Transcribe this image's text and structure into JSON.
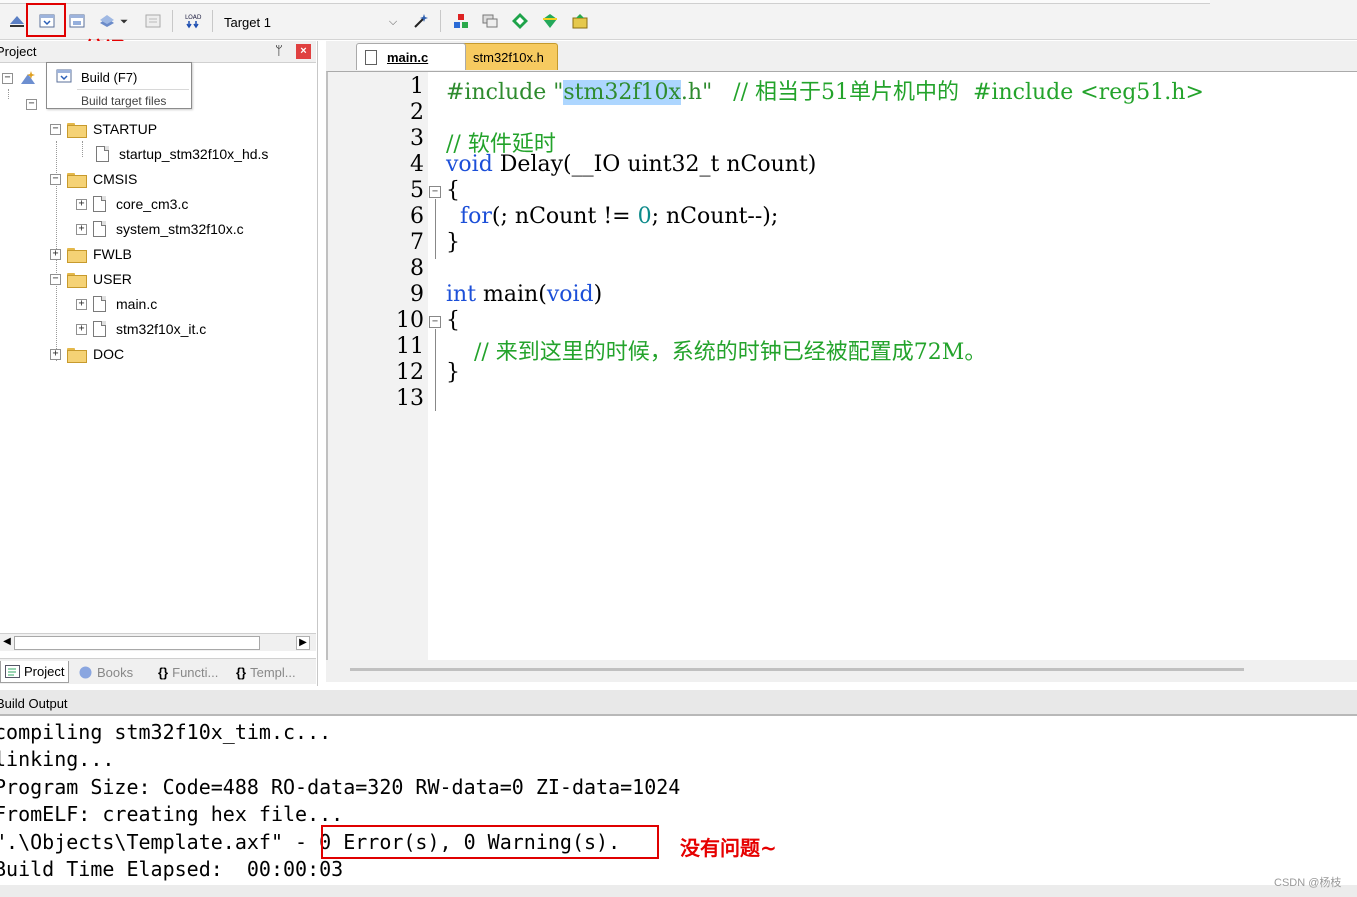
{
  "toolbar": {
    "target_label": "Target 1",
    "build_annotation": "编译"
  },
  "project_panel": {
    "title": "Project",
    "tooltip": {
      "title": "Build (F7)",
      "description": "Build target files"
    },
    "tree": [
      {
        "label": "STARTUP",
        "type": "folder",
        "expander": "⊟"
      },
      {
        "label": "startup_stm32f10x_hd.s",
        "type": "file",
        "expander": ""
      },
      {
        "label": "CMSIS",
        "type": "folder",
        "expander": "⊟"
      },
      {
        "label": "core_cm3.c",
        "type": "file",
        "expander": "⊞"
      },
      {
        "label": "system_stm32f10x.c",
        "type": "file",
        "expander": "⊞"
      },
      {
        "label": "FWLB",
        "type": "folder",
        "expander": "⊞"
      },
      {
        "label": "USER",
        "type": "folder",
        "expander": "⊟"
      },
      {
        "label": "main.c",
        "type": "file",
        "expander": "⊞"
      },
      {
        "label": "stm32f10x_it.c",
        "type": "file",
        "expander": "⊞"
      },
      {
        "label": "DOC",
        "type": "folder",
        "expander": "⊞"
      }
    ],
    "tabs": [
      {
        "label": "Project"
      },
      {
        "label": "Books"
      },
      {
        "label": "Functi..."
      },
      {
        "label": "Templ..."
      }
    ]
  },
  "editor": {
    "tabs": [
      {
        "label": "main.c"
      },
      {
        "label": "stm32f10x.h"
      }
    ],
    "line_numbers": [
      "1",
      "2",
      "3",
      "4",
      "5",
      "6",
      "7",
      "8",
      "9",
      "10",
      "11",
      "12",
      "13"
    ],
    "code": {
      "l1_include": "#include ",
      "l1_q1": "\"",
      "l1_sel": "stm32f10x",
      "l1_rest": ".h\"",
      "l1_comment": "   // 相当于51单片机中的  #include <reg51.h>",
      "l3_comment": "// 软件延时",
      "l4_kw": "void",
      "l4_rest": " Delay(__IO uint32_t nCount)",
      "l5": "{",
      "l6_indent": "  ",
      "l6_kw": "for",
      "l6_mid": "(; nCount != ",
      "l6_num": "0",
      "l6_rest": "; nCount--);",
      "l7": "}",
      "l9_kw1": "int",
      "l9_mid": " main(",
      "l9_kw2": "void",
      "l9_end": ")",
      "l10": "{",
      "l11_indent": "    ",
      "l11_comment": "// 来到这里的时候，系统的时钟已经被配置成72M。",
      "l12": "}"
    }
  },
  "build_output": {
    "title": "Build Output",
    "lines": [
      "compiling stm32f10x_tim.c...",
      "linking...",
      "Program Size: Code=488 RO-data=320 RW-data=0 ZI-data=1024",
      "FromELF: creating hex file...",
      "\".\\Objects\\Template.axf\" - 0 Error(s), 0 Warning(s).",
      "Build Time Elapsed:  00:00:03"
    ],
    "ok_annotation": "没有问题~",
    "watermark": "CSDN @杨枝"
  }
}
